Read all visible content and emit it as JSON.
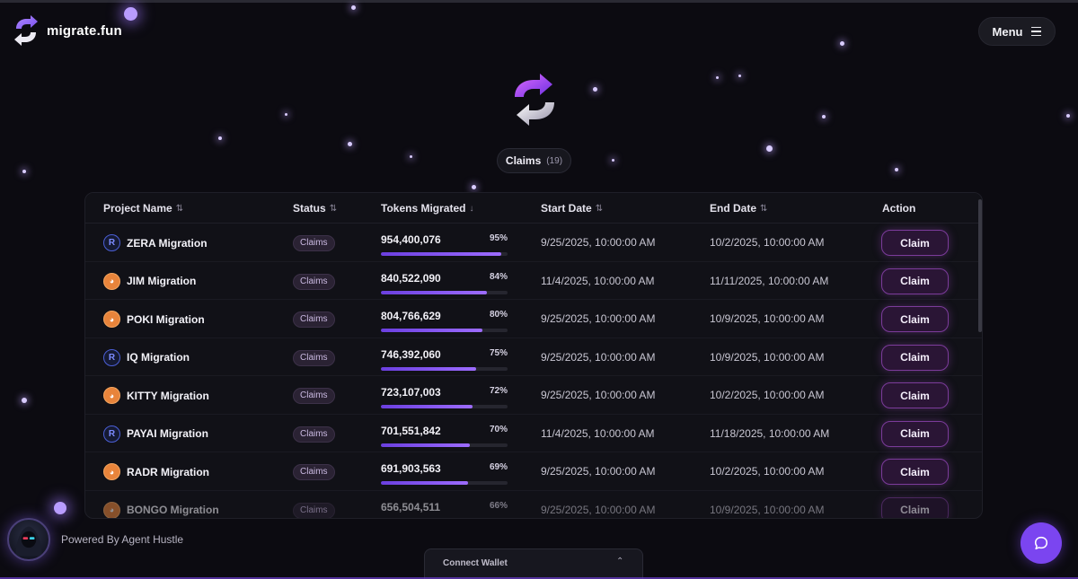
{
  "brand": {
    "name": "migrate.fun"
  },
  "header": {
    "menu_label": "Menu"
  },
  "hero": {
    "tab_label": "Claims",
    "tab_count": "(19)"
  },
  "table": {
    "columns": {
      "project": "Project Name",
      "status": "Status",
      "tokens": "Tokens Migrated",
      "start": "Start Date",
      "end": "End Date",
      "action": "Action"
    },
    "rows": [
      {
        "name": "ZERA Migration",
        "icon": "r-logo-icon",
        "status": "Claims",
        "tokens": "954,400,076",
        "pct": "95%",
        "progress": 0.95,
        "start": "9/25/2025, 10:00:00 AM",
        "end": "10/2/2025, 10:00:00 AM",
        "action": "Claim"
      },
      {
        "name": "JIM Migration",
        "icon": "orange-token-icon",
        "status": "Claims",
        "tokens": "840,522,090",
        "pct": "84%",
        "progress": 0.84,
        "start": "11/4/2025, 10:00:00 AM",
        "end": "11/11/2025, 10:00:00 AM",
        "action": "Claim"
      },
      {
        "name": "POKI Migration",
        "icon": "orange-token-icon",
        "status": "Claims",
        "tokens": "804,766,629",
        "pct": "80%",
        "progress": 0.8,
        "start": "9/25/2025, 10:00:00 AM",
        "end": "10/9/2025, 10:00:00 AM",
        "action": "Claim"
      },
      {
        "name": "IQ Migration",
        "icon": "r-logo-icon",
        "status": "Claims",
        "tokens": "746,392,060",
        "pct": "75%",
        "progress": 0.75,
        "start": "9/25/2025, 10:00:00 AM",
        "end": "10/9/2025, 10:00:00 AM",
        "action": "Claim"
      },
      {
        "name": "KITTY Migration",
        "icon": "orange-token-icon",
        "status": "Claims",
        "tokens": "723,107,003",
        "pct": "72%",
        "progress": 0.72,
        "start": "9/25/2025, 10:00:00 AM",
        "end": "10/2/2025, 10:00:00 AM",
        "action": "Claim"
      },
      {
        "name": "PAYAI Migration",
        "icon": "r-logo-icon",
        "status": "Claims",
        "tokens": "701,551,842",
        "pct": "70%",
        "progress": 0.7,
        "start": "11/4/2025, 10:00:00 AM",
        "end": "11/18/2025, 10:00:00 AM",
        "action": "Claim"
      },
      {
        "name": "RADR Migration",
        "icon": "orange-token-icon",
        "status": "Claims",
        "tokens": "691,903,563",
        "pct": "69%",
        "progress": 0.69,
        "start": "9/25/2025, 10:00:00 AM",
        "end": "10/2/2025, 10:00:00 AM",
        "action": "Claim"
      },
      {
        "name": "BONGO Migration",
        "icon": "orange-token-icon",
        "status": "Claims",
        "tokens": "656,504,511",
        "pct": "66%",
        "progress": 0.66,
        "start": "9/25/2025, 10:00:00 AM",
        "end": "10/9/2025, 10:00:00 AM",
        "action": "Claim"
      }
    ]
  },
  "footer": {
    "powered_by": "Powered By Agent Hustle",
    "wallet_label": "Connect Wallet"
  },
  "colors": {
    "accent": "#7b45f0",
    "background": "#0c0b11",
    "claim_border": "#7b3b9a"
  }
}
